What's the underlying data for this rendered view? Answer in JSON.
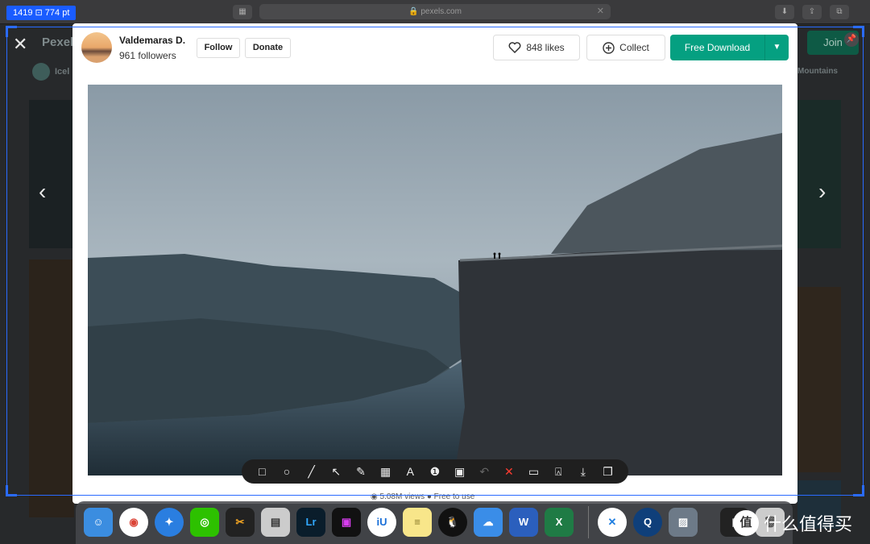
{
  "topbar": {
    "dims_label": "1419 ⊡ 774 pt",
    "url": "🔒 pexels.com"
  },
  "background": {
    "logo": "Pexels",
    "join": "Join",
    "author": "Icel",
    "tag": "Mountains"
  },
  "modal": {
    "author_name": "Valdemaras D.",
    "followers": "961 followers",
    "follow_label": "Follow",
    "donate_label": "Donate",
    "likes_label": "848 likes",
    "collect_label": "Collect",
    "download_label": "Free Download",
    "views_text": "◉ 5.08M views   ● Free to use"
  },
  "watermark": {
    "badge": "值",
    "text": "什么值得买"
  },
  "colors": {
    "accent_green": "#05a081",
    "selection_blue": "#2a6bff"
  }
}
